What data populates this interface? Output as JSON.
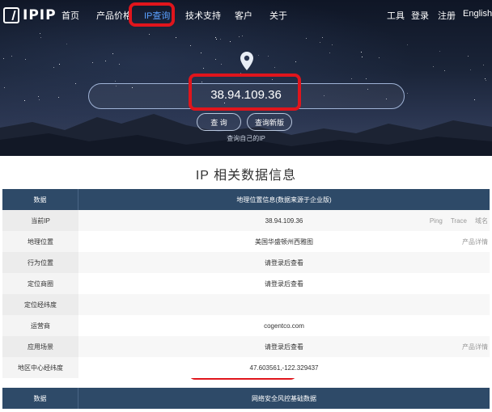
{
  "brand": {
    "name": "IPIP"
  },
  "nav": {
    "items": [
      {
        "label": "首页"
      },
      {
        "label": "产品价格"
      },
      {
        "label": "IP查询"
      },
      {
        "label": "技术支持"
      },
      {
        "label": "客户"
      },
      {
        "label": "关于"
      }
    ],
    "right": [
      {
        "label": "工具"
      },
      {
        "label": "登录"
      },
      {
        "label": "注册"
      },
      {
        "label": "English"
      }
    ]
  },
  "search": {
    "value": "38.94.109.36",
    "query_label": "查 询",
    "query_new_label": "查询新版",
    "self_ip_link": "查询自己的IP"
  },
  "section_title": "IP 相关数据信息",
  "table": {
    "header": {
      "label": "数据",
      "value": "地理位置信息(数据来源于企业版)"
    },
    "rows": [
      {
        "label": "当前IP",
        "value": "38.94.109.36",
        "extras": [
          "Ping",
          "Trace",
          "域名"
        ]
      },
      {
        "label": "地理位置",
        "value": "美国华盛顿州西雅图",
        "extras": [
          "产品详情"
        ]
      },
      {
        "label": "行为位置",
        "value": "请登录后查看",
        "extras": []
      },
      {
        "label": "定位商圈",
        "value": "请登录后查看",
        "extras": []
      },
      {
        "label": "定位经纬度",
        "value": "",
        "extras": []
      },
      {
        "label": "运营商",
        "value": "cogentco.com",
        "extras": []
      },
      {
        "label": "应用场景",
        "value": "请登录后查看",
        "extras": [
          "产品详情"
        ]
      },
      {
        "label": "地区中心经纬度",
        "value": "47.603561,-122.329437",
        "extras": []
      }
    ]
  },
  "table2": {
    "header": {
      "label": "数据",
      "value": "网络安全风控基础数据"
    }
  },
  "colors": {
    "highlight": "#e0151c",
    "active_nav": "#5aa0ff",
    "table_header": "#2e4a68"
  },
  "icons": {
    "location": "location-pin-icon",
    "logo": "ipip-logo-icon"
  }
}
